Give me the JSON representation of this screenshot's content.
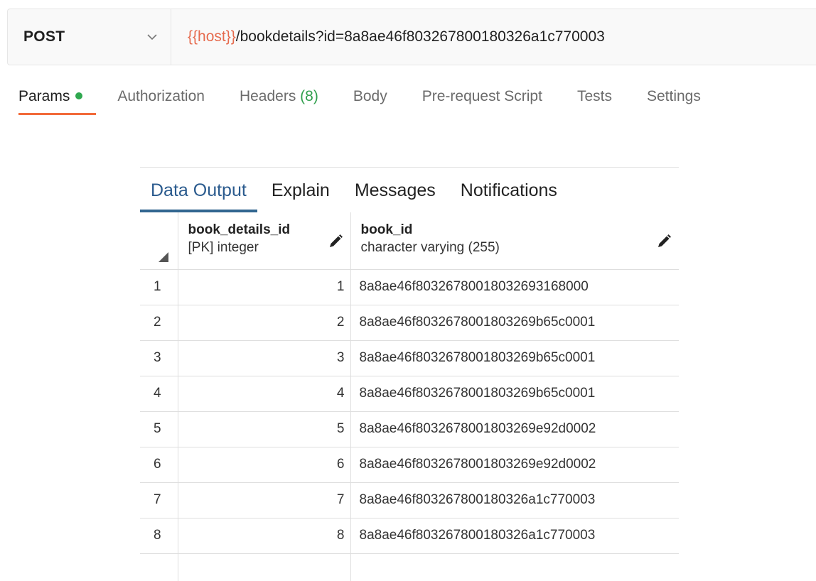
{
  "request": {
    "method": "POST",
    "url_variable": "{{host}}",
    "url_path": "/bookdetails?id=8a8ae46f803267800180326a1c770003"
  },
  "request_tabs": [
    {
      "label": "Params",
      "dot_color": "#2fa84f"
    },
    {
      "label": "Authorization"
    },
    {
      "label": "Headers",
      "count": "(8)"
    },
    {
      "label": "Body"
    },
    {
      "label": "Pre-request Script"
    },
    {
      "label": "Tests"
    },
    {
      "label": "Settings"
    }
  ],
  "result_tabs": [
    "Data Output",
    "Explain",
    "Messages",
    "Notifications"
  ],
  "table": {
    "columns": [
      {
        "name": "book_details_id",
        "type": "[PK] integer"
      },
      {
        "name": "book_id",
        "type": "character varying (255)"
      }
    ],
    "rows": [
      {
        "n": "1",
        "id": "1",
        "book_id": "8a8ae46f80326780018032693168000"
      },
      {
        "n": "2",
        "id": "2",
        "book_id": "8a8ae46f8032678001803269b65c0001"
      },
      {
        "n": "3",
        "id": "3",
        "book_id": "8a8ae46f8032678001803269b65c0001"
      },
      {
        "n": "4",
        "id": "4",
        "book_id": "8a8ae46f8032678001803269b65c0001"
      },
      {
        "n": "5",
        "id": "5",
        "book_id": "8a8ae46f8032678001803269e92d0002"
      },
      {
        "n": "6",
        "id": "6",
        "book_id": "8a8ae46f8032678001803269e92d0002"
      },
      {
        "n": "7",
        "id": "7",
        "book_id": "8a8ae46f803267800180326a1c770003"
      },
      {
        "n": "8",
        "id": "8",
        "book_id": "8a8ae46f803267800180326a1c770003"
      }
    ]
  },
  "colors": {
    "url_variable": "#e66b4e",
    "active_tab_underline": "#f26b3a",
    "headers_count": "#2f9f4c",
    "data_output_active": "#326690"
  }
}
